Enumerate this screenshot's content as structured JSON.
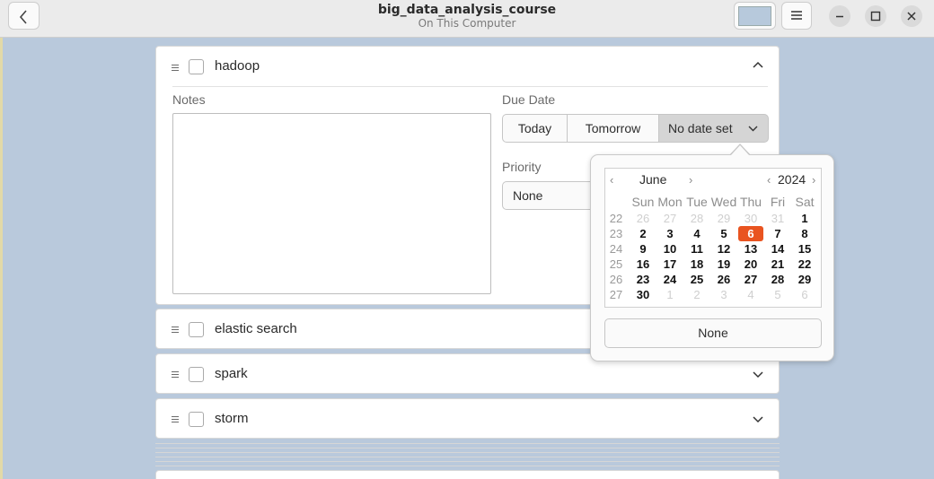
{
  "header": {
    "title": "big_data_analysis_course",
    "subtitle": "On This Computer",
    "list_color": "#b7c9dc"
  },
  "tasks": [
    {
      "title": "hadoop",
      "expanded": true
    },
    {
      "title": "elastic search",
      "expanded": false
    },
    {
      "title": "spark",
      "expanded": false
    },
    {
      "title": "storm",
      "expanded": false
    }
  ],
  "detail": {
    "notes_label": "Notes",
    "notes_value": "",
    "due_date_label": "Due Date",
    "due_options": [
      "Today",
      "Tomorrow",
      "No date set"
    ],
    "priority_label": "Priority",
    "priority_value": "None"
  },
  "calendar": {
    "month": "June",
    "year": "2024",
    "weekdays": [
      "Sun",
      "Mon",
      "Tue",
      "Wed",
      "Thu",
      "Fri",
      "Sat"
    ],
    "week_numbers": [
      "22",
      "23",
      "24",
      "25",
      "26",
      "27"
    ],
    "weeks": [
      [
        "26",
        "27",
        "28",
        "29",
        "30",
        "31",
        "1"
      ],
      [
        "2",
        "3",
        "4",
        "5",
        "6",
        "7",
        "8"
      ],
      [
        "9",
        "10",
        "11",
        "12",
        "13",
        "14",
        "15"
      ],
      [
        "16",
        "17",
        "18",
        "19",
        "20",
        "21",
        "22"
      ],
      [
        "23",
        "24",
        "25",
        "26",
        "27",
        "28",
        "29"
      ],
      [
        "30",
        "1",
        "2",
        "3",
        "4",
        "5",
        "6"
      ]
    ],
    "selected_day": "6",
    "accent_color": "#e95420",
    "none_label": "None"
  }
}
